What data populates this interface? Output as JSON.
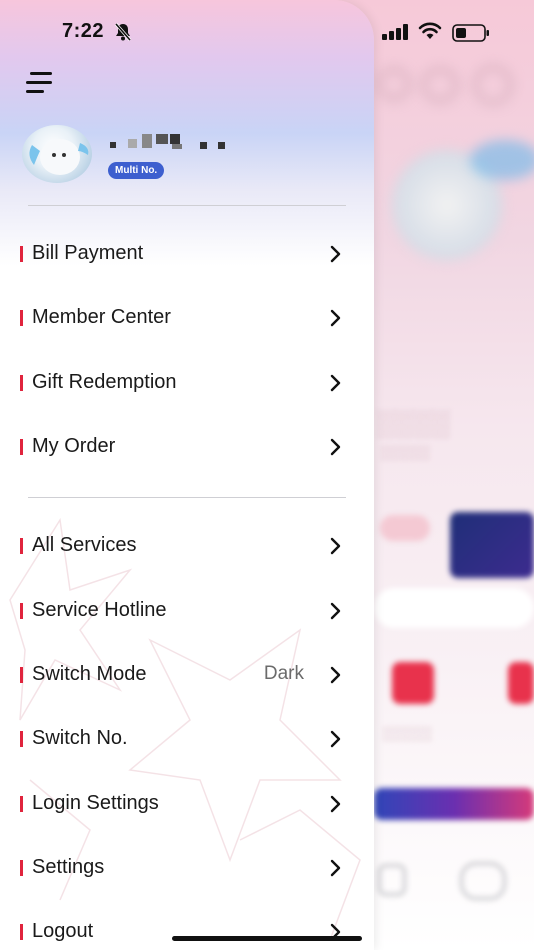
{
  "status_bar": {
    "time": "7:22"
  },
  "profile": {
    "badge": "Multi No."
  },
  "menu_group_1": [
    {
      "label": "Bill Payment"
    },
    {
      "label": "Member Center"
    },
    {
      "label": "Gift Redemption"
    },
    {
      "label": "My Order"
    }
  ],
  "menu_group_2": [
    {
      "label": "All Services"
    },
    {
      "label": "Service Hotline"
    },
    {
      "label": "Switch Mode",
      "value": "Dark"
    },
    {
      "label": "Switch No."
    },
    {
      "label": "Login Settings"
    },
    {
      "label": "Settings"
    },
    {
      "label": "Logout"
    }
  ],
  "colors": {
    "accent": "#e0243d",
    "badge": "#3d5fcf"
  }
}
